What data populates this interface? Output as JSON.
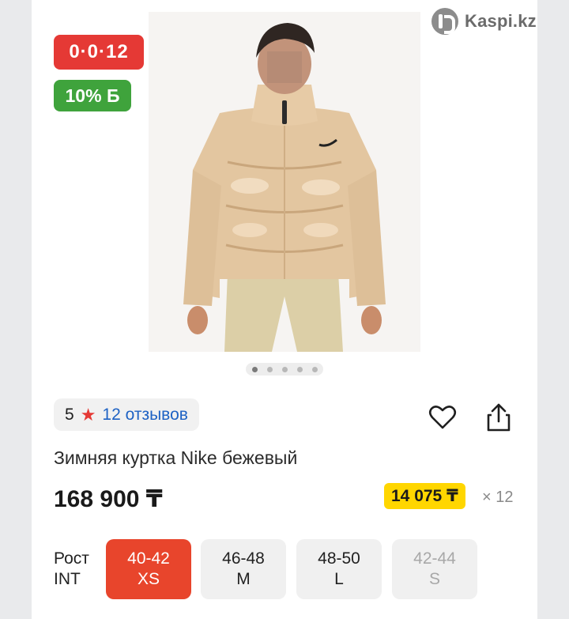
{
  "brand": {
    "name": "Kaspi.kz",
    "icon": "kaspi-logo-icon"
  },
  "badges": {
    "installment": "0·0·12",
    "bonus": "10% Б"
  },
  "gallery": {
    "slides": 5,
    "active_index": 0
  },
  "rating": {
    "score": "5",
    "reviews": "12 отзывов",
    "star_color": "#e53935"
  },
  "product": {
    "title": "Зимняя куртка Nike бежевый",
    "price": "168 900 ₸",
    "monthly_payment": "14 075 ₸",
    "months": "× 12"
  },
  "sizes": {
    "label_line1": "Рост",
    "label_line2": "INT",
    "options": [
      {
        "range": "40-42",
        "size": "XS",
        "state": "selected"
      },
      {
        "range": "46-48",
        "size": "M",
        "state": "available"
      },
      {
        "range": "48-50",
        "size": "L",
        "state": "available"
      },
      {
        "range": "42-44",
        "size": "S",
        "state": "disabled"
      }
    ]
  },
  "colors": {
    "accent_red": "#e53935",
    "bonus_green": "#3fa33c",
    "installment_yellow": "#ffd600",
    "link_blue": "#1e62c4"
  }
}
